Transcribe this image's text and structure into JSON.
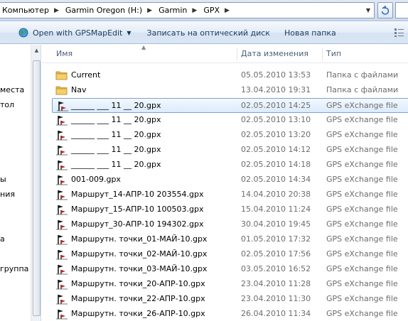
{
  "address": {
    "crumbs": [
      "Компьютер",
      "Garmin Oregon (H:)",
      "Garmin",
      "GPX"
    ]
  },
  "toolbar": {
    "open_with_label": "Open with GPSMapEdit",
    "burn_label": "Записать на оптический диск",
    "new_folder_label": "Новая папка"
  },
  "nav": {
    "items": [
      "места",
      "тол",
      "ы",
      "ния",
      "а",
      "группа"
    ]
  },
  "columns": {
    "name": "Имя",
    "date": "Дата изменения",
    "type": "Тип"
  },
  "files": [
    {
      "name": "Current",
      "date": "05.05.2010 13:53",
      "type": "Папка с файлами",
      "icon": "folder-icon"
    },
    {
      "name": "Nav",
      "date": "13.04.2010 19:31",
      "type": "Папка с файлами",
      "icon": "folder-icon"
    },
    {
      "name": "______ ___ 11 __ 20.gpx",
      "date": "02.05.2010 14:25",
      "type": "GPS eXchange file",
      "icon": "gpx-file-icon",
      "selected": true
    },
    {
      "name": "______ ___ 11 __ 20.gpx",
      "date": "02.05.2010 13:10",
      "type": "GPS eXchange file",
      "icon": "gpx-file-icon"
    },
    {
      "name": "______ ___ 11 __ 20.gpx",
      "date": "02.05.2010 13:20",
      "type": "GPS eXchange file",
      "icon": "gpx-file-icon"
    },
    {
      "name": "______ ___ 11 __ 20.gpx",
      "date": "02.05.2010 14:12",
      "type": "GPS eXchange file",
      "icon": "gpx-file-icon"
    },
    {
      "name": "______ ___ 11 __ 20.gpx",
      "date": "02.05.2010 14:18",
      "type": "GPS eXchange file",
      "icon": "gpx-file-icon"
    },
    {
      "name": "001-009.gpx",
      "date": "02.05.2010 14:34",
      "type": "GPS eXchange file",
      "icon": "gpx-file-icon"
    },
    {
      "name": "Маршрут_14-АПР-10 203554.gpx",
      "date": "14.04.2010 20:38",
      "type": "GPS eXchange file",
      "icon": "gpx-file-icon"
    },
    {
      "name": "Маршрут_15-АПР-10 100503.gpx",
      "date": "15.04.2010 11:24",
      "type": "GPS eXchange file",
      "icon": "gpx-file-icon"
    },
    {
      "name": "Маршрут_30-АПР-10 194302.gpx",
      "date": "30.04.2010 19:45",
      "type": "GPS eXchange file",
      "icon": "gpx-file-icon"
    },
    {
      "name": "Маршрутн. точки_01-МАЙ-10.gpx",
      "date": "01.05.2010 17:32",
      "type": "GPS eXchange file",
      "icon": "gpx-file-icon"
    },
    {
      "name": "Маршрутн. точки_02-МАЙ-10.gpx",
      "date": "02.05.2010 17:56",
      "type": "GPS eXchange file",
      "icon": "gpx-file-icon"
    },
    {
      "name": "Маршрутн. точки_03-МАЙ-10.gpx",
      "date": "03.05.2010 16:52",
      "type": "GPS eXchange file",
      "icon": "gpx-file-icon"
    },
    {
      "name": "Маршрутн. точки_20-АПР-10.gpx",
      "date": "23.04.2010 11:28",
      "type": "GPS eXchange file",
      "icon": "gpx-file-icon"
    },
    {
      "name": "Маршрутн. точки_22-АПР-10.gpx",
      "date": "23.04.2010 11:30",
      "type": "GPS eXchange file",
      "icon": "gpx-file-icon"
    },
    {
      "name": "Маршрутн. точки_26-АПР-10.gpx",
      "date": "26.04.2010 11:34",
      "type": "GPS eXchange file",
      "icon": "gpx-file-icon"
    }
  ]
}
